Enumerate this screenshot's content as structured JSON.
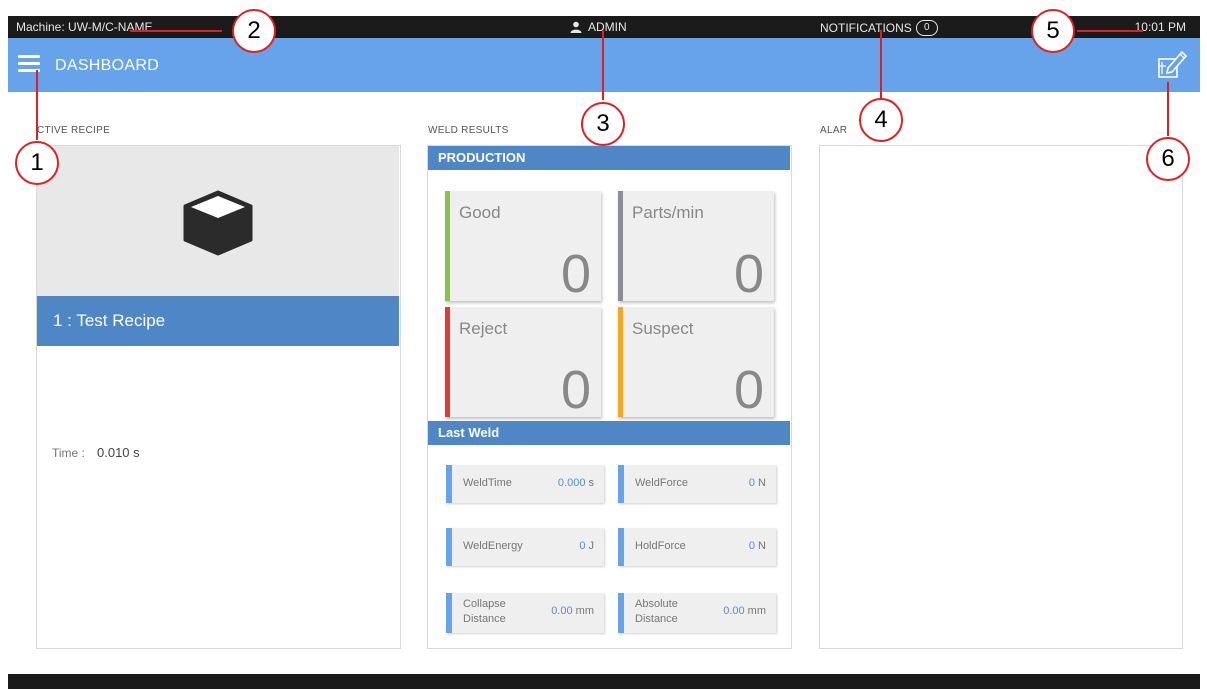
{
  "statusbar": {
    "machine": "Machine: UW-M/C-NAME",
    "user": "ADMIN",
    "notifications_label": "NOTIFICATIONS",
    "notifications_count": "0",
    "time": "10:01 PM"
  },
  "header": {
    "title": "DASHBOARD"
  },
  "sections": {
    "active_recipe": "CTIVE RECIPE",
    "weld_results": "WELD RESULTS",
    "alarms": "ALAR"
  },
  "recipe": {
    "name": "1 : Test Recipe",
    "time_label": "Time :",
    "time_value": "0.010 s"
  },
  "production": {
    "title": "PRODUCTION",
    "cards": [
      {
        "label": "Good",
        "value": "0",
        "color": "#8bc34a"
      },
      {
        "label": "Parts/min",
        "value": "0",
        "color": "#8a8f96"
      },
      {
        "label": "Reject",
        "value": "0",
        "color": "#e53935"
      },
      {
        "label": "Suspect",
        "value": "0",
        "color": "#f5a623"
      }
    ]
  },
  "last_weld": {
    "title": "Last Weld",
    "items": [
      {
        "label": "WeldTime",
        "value": "0.000",
        "unit": "s"
      },
      {
        "label": "WeldForce",
        "value": "0",
        "unit": "N"
      },
      {
        "label": "WeldEnergy",
        "value": "0",
        "unit": "J"
      },
      {
        "label": "HoldForce",
        "value": "0",
        "unit": "N"
      },
      {
        "label_line1": "Collapse",
        "label_line2": "Distance",
        "value": "0.00",
        "unit": "mm"
      },
      {
        "label_line1": "Absolute",
        "label_line2": "Distance",
        "value": "0.00",
        "unit": "mm"
      }
    ]
  },
  "callouts": [
    "1",
    "2",
    "3",
    "4",
    "5",
    "6"
  ],
  "icons": {
    "menu": "hamburger-menu-icon",
    "user": "user-icon",
    "recipe": "cube-icon",
    "edit": "edit-layout-icon"
  }
}
